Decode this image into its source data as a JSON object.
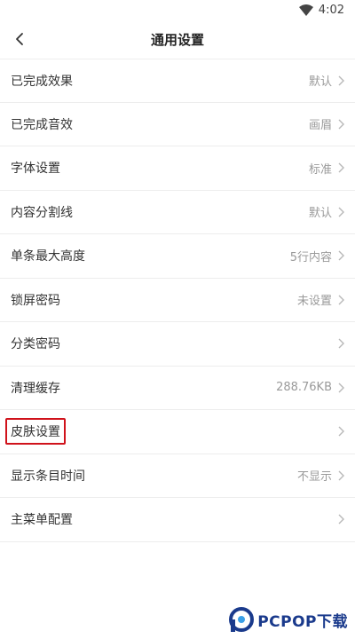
{
  "status_bar": {
    "time": "4:02",
    "icons": [
      "wifi-icon"
    ]
  },
  "header": {
    "title": "通用设置",
    "back_icon": "chevron-left-icon"
  },
  "settings": [
    {
      "label": "已完成效果",
      "value": "默认"
    },
    {
      "label": "已完成音效",
      "value": "画眉"
    },
    {
      "label": "字体设置",
      "value": "标准"
    },
    {
      "label": "内容分割线",
      "value": "默认"
    },
    {
      "label": "单条最大高度",
      "value": "5行内容"
    },
    {
      "label": "锁屏密码",
      "value": "未设置"
    },
    {
      "label": "分类密码",
      "value": ""
    },
    {
      "label": "清理缓存",
      "value": "288.76KB"
    },
    {
      "label": "皮肤设置",
      "value": "",
      "highlighted": true
    },
    {
      "label": "显示条目时间",
      "value": "不显示"
    },
    {
      "label": "主菜单配置",
      "value": ""
    }
  ],
  "watermark": {
    "text": "PCPOP下载"
  },
  "colors": {
    "highlight": "#d0121b",
    "divider": "#ededed",
    "value_text": "#9a9a9a",
    "watermark": "#1a3a8c"
  }
}
